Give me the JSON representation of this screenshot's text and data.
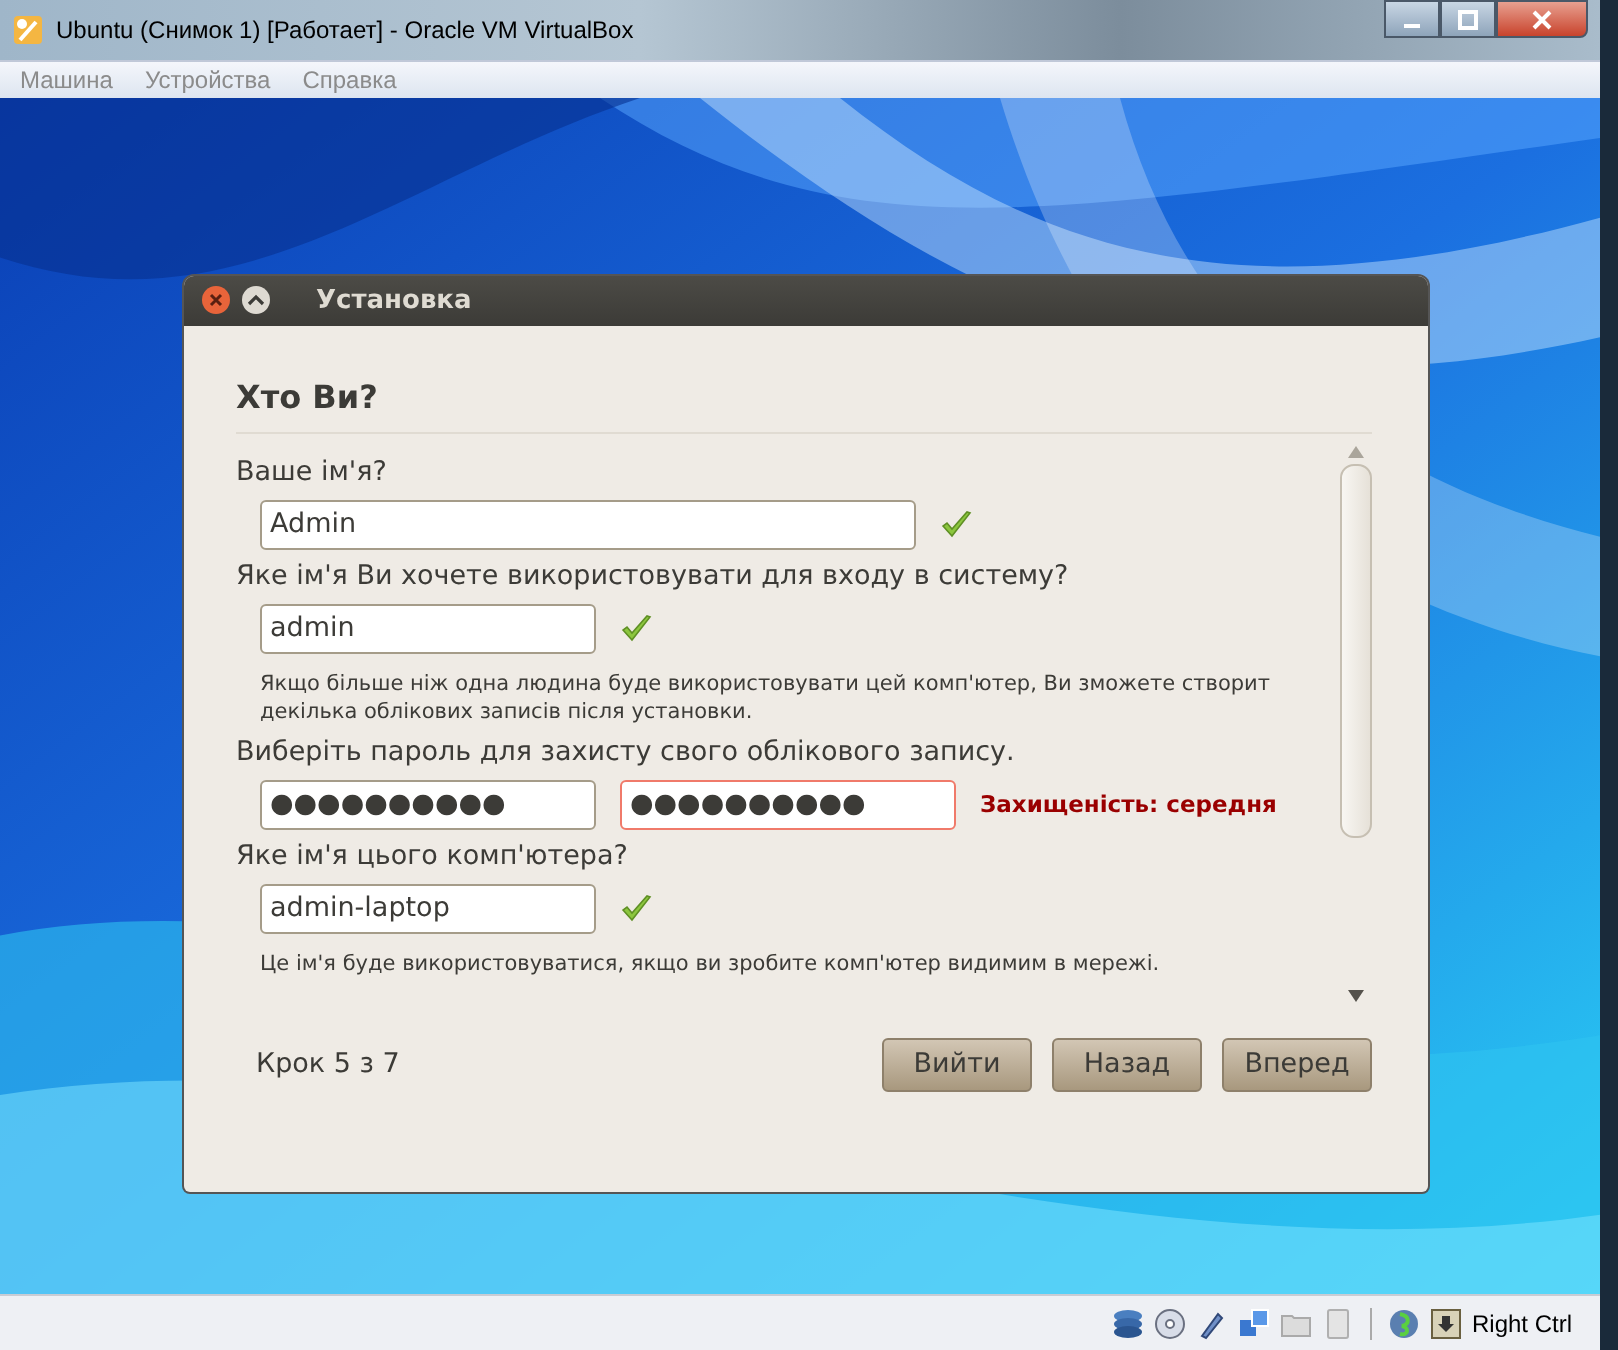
{
  "window": {
    "title": "Ubuntu (Снимок 1) [Работает] - Oracle VM VirtualBox"
  },
  "menu": [
    "Машина",
    "Устройства",
    "Справка"
  ],
  "dialog": {
    "title": "Установка",
    "heading": "Хто Ви?",
    "sections": [
      {
        "label": "Ваше ім'я?",
        "fields": [
          {
            "value": "Admin",
            "wide": true,
            "valid": true,
            "error": false
          }
        ]
      },
      {
        "label": "Яке ім'я Ви хочете використовувати для входу в систему?",
        "fields": [
          {
            "value": "admin",
            "wide": false,
            "valid": true,
            "error": false
          }
        ],
        "hint_lines": [
          "Якщо більше ніж одна людина буде використовувати цей комп'ютер, Ви зможете створит",
          "декілька облікових записів після установки."
        ]
      },
      {
        "label": "Виберіть пароль для захисту свого облікового запису.",
        "fields": [
          {
            "value": "●●●●●●●●●●",
            "wide": false,
            "valid": false,
            "error": false
          },
          {
            "value": "●●●●●●●●●●",
            "wide": false,
            "valid": false,
            "error": true
          }
        ],
        "strength": "Захищеність: середня"
      },
      {
        "label": "Яке ім'я цього комп'ютера?",
        "fields": [
          {
            "value": "admin-laptop",
            "wide": false,
            "valid": true,
            "error": false
          }
        ],
        "hint_lines": [
          "Це ім'я буде використовуватися, якщо ви зробите комп'ютер видимим в мережі."
        ]
      }
    ],
    "step": "Крок 5 з 7",
    "buttons": [
      "Вийти",
      "Назад",
      "Вперед"
    ]
  },
  "status_bar": {
    "host_key": "Right Ctrl"
  }
}
